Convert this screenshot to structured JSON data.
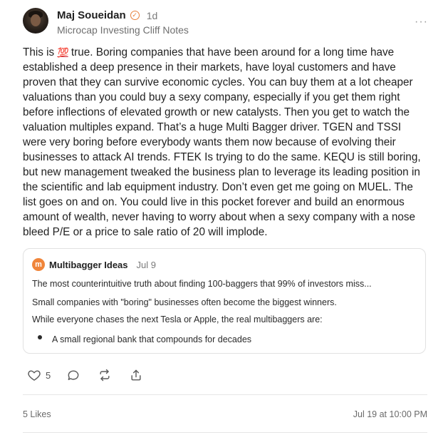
{
  "post": {
    "author": "Maj Soueidan",
    "time": "1d",
    "publication": "Microcap Investing Cliff Notes",
    "more_label": "···",
    "emoji": "💯",
    "text_before_emoji": "This is",
    "text_after_emoji": "true. Boring companies that have been around for a long time have established a deep presence in their markets, have loyal customers and have proven that they can survive economic cycles. You can buy them at a lot cheaper valuations than you could buy a sexy company, especially if you get them right before inflections of elevated growth or new catalysts. Then you get to watch the valuation multiples expand. That’s a huge Multi Bagger driver. TGEN and TSSI were very boring before everybody wants them now because of evolving their businesses to attack AI trends. FTEK Is trying to do the same. KEQU is still boring, but new management tweaked the business plan to leverage its leading position in the scientific and lab equipment industry. Don’t even get me going on MUEL. The list goes on and on. You could live in this pocket forever and build an enormous amount of wealth, never having to worry about when a sexy company with a nose bleed P/E or a price to sale ratio of 20 will implode."
  },
  "quote": {
    "logo_letter": "m",
    "name": "Multibagger Ideas",
    "date": "Jul 9",
    "line1": "The most counterintuitive truth about finding 100-baggers that 99% of investors miss...",
    "line2": "Small companies with \"boring\" businesses often become the biggest winners.",
    "line3": "While everyone chases the next Tesla or Apple, the real multibaggers are:",
    "bullet1": "A small regional bank that compounds for decades"
  },
  "actions": {
    "like_count": "5"
  },
  "footer": {
    "likes": "5 Likes",
    "timestamp": "Jul 19 at 10:00 PM"
  },
  "colors": {
    "accent": "#e8813b",
    "quote_logo": "#f0853a",
    "emoji_red": "#c81c2b"
  }
}
